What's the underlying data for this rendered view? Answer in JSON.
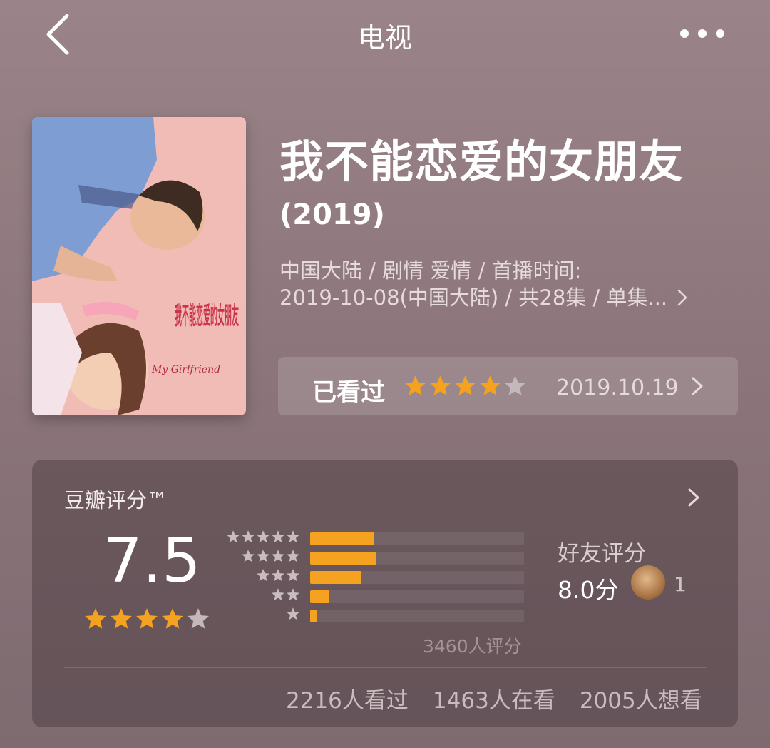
{
  "header": {
    "title": "电视",
    "back_icon": "chevron-left-icon",
    "more_icon": "more-dots-icon"
  },
  "poster": {
    "title_text": "我不能恋爱的女朋友",
    "english_text": "My Girlfriend"
  },
  "movie": {
    "name": "我不能恋爱的女朋友",
    "year": "(2019)",
    "meta_line1": "中国大陆 / 剧情 爱情 / 首播时间:",
    "meta_line2": "2019-10-08(中国大陆) / 共28集 / 单集..."
  },
  "watched": {
    "label": "已看过",
    "user_rating": 4,
    "max_rating": 5,
    "date": "2019.10.19"
  },
  "rating_card": {
    "title": "豆瓣评分™",
    "score": "7.5",
    "score_stars": 4,
    "distribution": [
      {
        "stars": 5,
        "fraction": 0.3
      },
      {
        "stars": 4,
        "fraction": 0.31
      },
      {
        "stars": 3,
        "fraction": 0.24
      },
      {
        "stars": 2,
        "fraction": 0.09
      },
      {
        "stars": 1,
        "fraction": 0.03
      }
    ],
    "rating_count": "3460人评分",
    "friend_label": "好友评分",
    "friend_score": "8.0分",
    "friend_count": "1",
    "stats": [
      "2216人看过",
      "1463人在看",
      "2005人想看"
    ]
  },
  "colors": {
    "accent_star": "#f4a21f",
    "star_empty": "#c4b8bb"
  }
}
